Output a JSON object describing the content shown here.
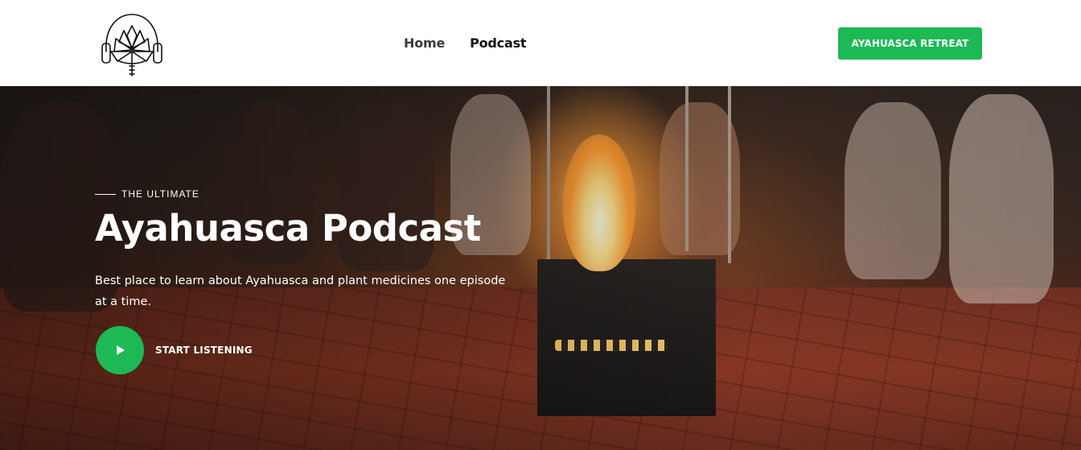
{
  "header": {
    "logo": {
      "icon": "lotus-headphones-logo-icon"
    },
    "nav": [
      {
        "label": "Home"
      },
      {
        "label": "Podcast"
      }
    ],
    "cta_label": "AYAHUASCA RETREAT"
  },
  "hero": {
    "eyebrow": "THE ULTIMATE",
    "title": "Ayahuasca Podcast",
    "description": "Best place to learn about Ayahuasca and plant medicines one episode at a time.",
    "listen_label": "START LISTENING",
    "play_icon": "play-icon",
    "background_image": "people-sitting-around-fire-pit-at-night"
  },
  "colors": {
    "accent": "#1db954",
    "header_bg": "#ffffff",
    "nav_text": "#111111",
    "hero_text": "#ffffff"
  }
}
